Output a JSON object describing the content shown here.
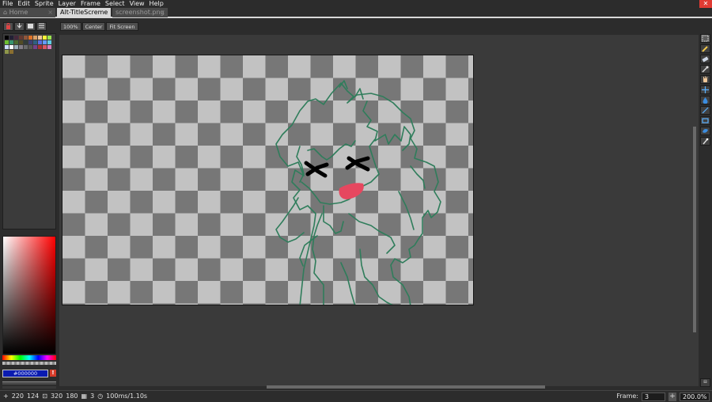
{
  "menu": [
    "File",
    "Edit",
    "Sprite",
    "Layer",
    "Frame",
    "Select",
    "View",
    "Help"
  ],
  "close_symbol": "✕",
  "tabs": [
    {
      "label": "Home",
      "active": false,
      "icon": "home-icon"
    },
    {
      "label": "Alt-TitleScreme",
      "active": true
    },
    {
      "label": "screenshot.png",
      "active": false
    }
  ],
  "tab_close": "×",
  "context_bar": {
    "zoom_100": "100%",
    "center": "Center",
    "fit_screen": "Fit Screen"
  },
  "palette": {
    "colors": [
      "#000000",
      "#222034",
      "#45283c",
      "#663931",
      "#8f563b",
      "#df7126",
      "#d9a066",
      "#eec39a",
      "#fbf236",
      "#99e550",
      "#6abe30",
      "#37946e",
      "#4b692f",
      "#524b24",
      "#323c39",
      "#3f3f74",
      "#306082",
      "#5b6ee1",
      "#639bff",
      "#5fcde4",
      "#cbdbfc",
      "#ffffff",
      "#9badb7",
      "#847e87",
      "#696a6a",
      "#595652",
      "#76428a",
      "#ac3232",
      "#d95763",
      "#d77bba",
      "#8f974a",
      "#8a6f30"
    ]
  },
  "color_bar": {
    "hex": "#000000",
    "warning": "!"
  },
  "status": {
    "cursor_x": "220",
    "cursor_y": "124",
    "size_w": "320",
    "size_h": "180",
    "frames": "3",
    "duration": "100ms/1.10s",
    "frame_label": "Frame:",
    "frame_value": "3",
    "zoom": "200.0%"
  },
  "toolbar_icons": [
    "marquee-icon",
    "pencil-icon",
    "eraser-icon",
    "eyedropper-icon",
    "hand-icon",
    "move-icon",
    "paint-bucket-icon",
    "line-icon",
    "rectangle-icon",
    "contour-icon",
    "blur-icon"
  ],
  "colors": {
    "accent_red": "#e03b33",
    "stroke_green": "#2f7d5b",
    "mouth_pink": "#e6475f"
  }
}
